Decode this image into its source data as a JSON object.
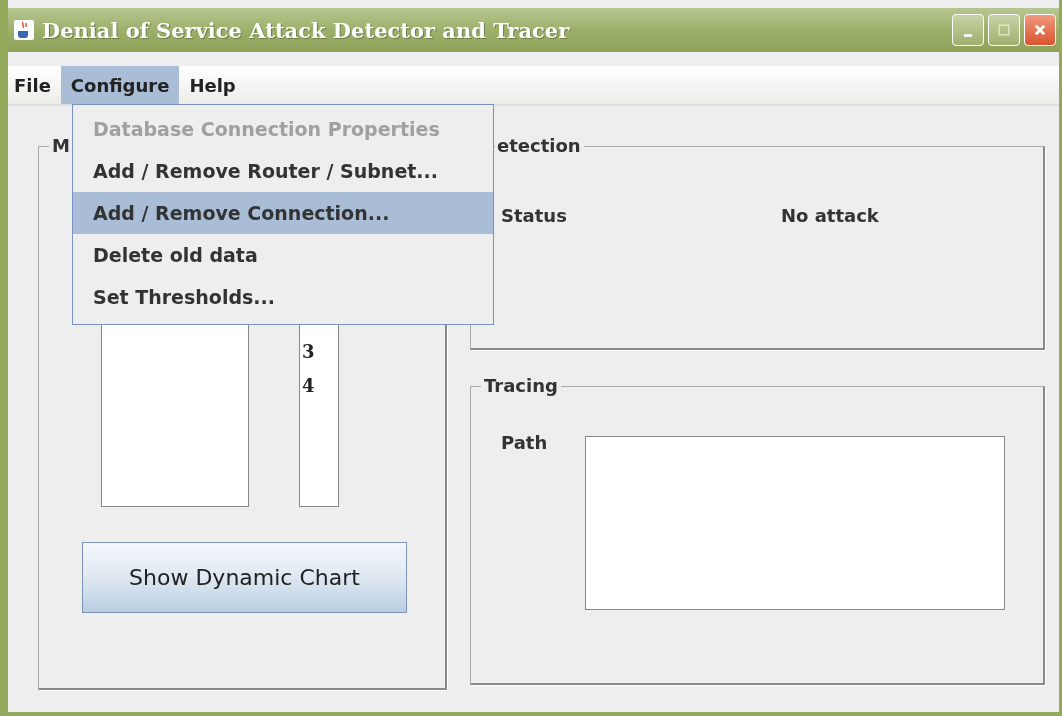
{
  "window": {
    "title": "Denial of Service Attack Detector and Tracer"
  },
  "menu_bar": [
    {
      "label": "File",
      "selected": false
    },
    {
      "label": "Configure",
      "selected": true
    },
    {
      "label": "Help",
      "selected": false
    }
  ],
  "menu": {
    "items": [
      {
        "label": "Database Connection Properties",
        "disabled": true,
        "selected": false
      },
      {
        "label": "Add / Remove Router / Subnet...",
        "disabled": false,
        "selected": false
      },
      {
        "label": "Add / Remove Connection...",
        "disabled": false,
        "selected": true
      },
      {
        "label": "Delete old data",
        "disabled": false,
        "selected": false
      },
      {
        "label": "Set Thresholds...",
        "disabled": false,
        "selected": false
      }
    ]
  },
  "left_panel": {
    "title": "M",
    "number_list": [
      "3",
      "4"
    ],
    "button": "Show Dynamic Chart"
  },
  "detection": {
    "title": "etection",
    "status_label": "Status",
    "status_value": "No attack"
  },
  "tracing": {
    "title": "Tracing",
    "path_label": "Path"
  }
}
